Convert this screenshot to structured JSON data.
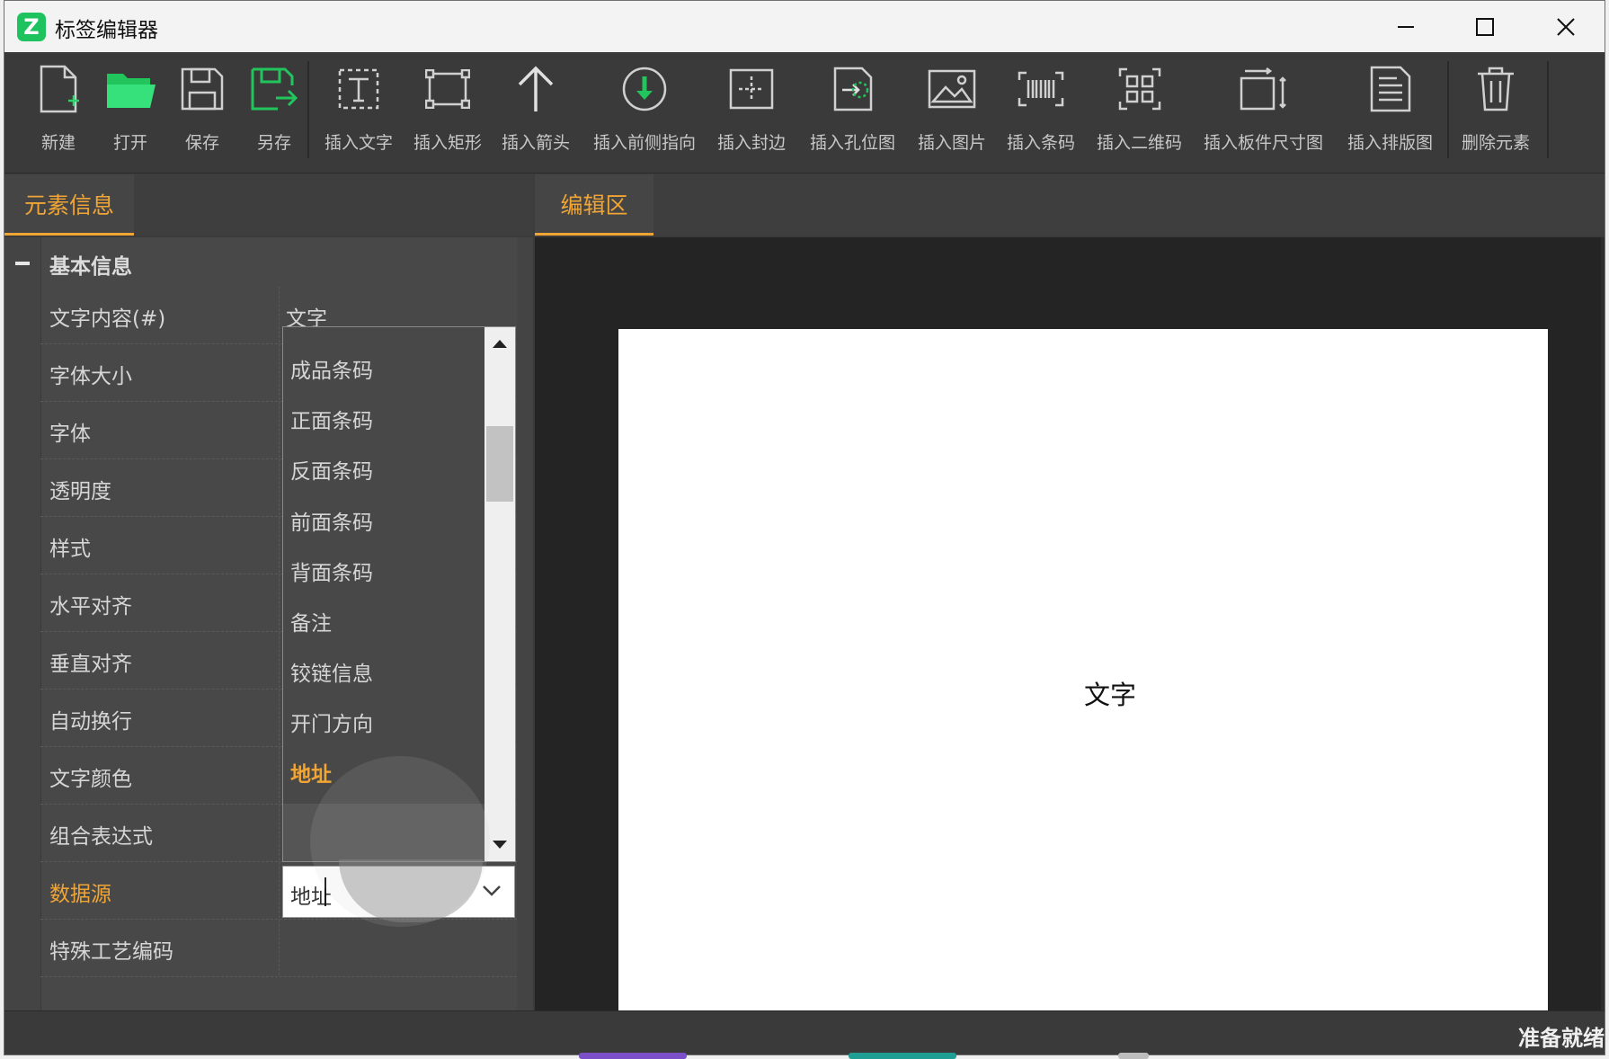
{
  "app": {
    "title": "标签编辑器",
    "icon_letter": "Z",
    "accent_color": "#f0a535",
    "brand_color": "#1ec25f"
  },
  "window_controls": {
    "minimize": "minimize-icon",
    "maximize": "maximize-icon",
    "close": "close-icon"
  },
  "toolbar": {
    "items": [
      {
        "label": "新建",
        "icon": "new-file-icon"
      },
      {
        "label": "打开",
        "icon": "open-folder-icon"
      },
      {
        "label": "保存",
        "icon": "save-icon"
      },
      {
        "label": "另存",
        "icon": "save-as-icon"
      },
      {
        "label": "插入文字",
        "icon": "insert-text-icon"
      },
      {
        "label": "插入矩形",
        "icon": "insert-rect-icon"
      },
      {
        "label": "插入箭头",
        "icon": "insert-arrow-icon"
      },
      {
        "label": "插入前侧指向",
        "icon": "insert-front-direction-icon"
      },
      {
        "label": "插入封边",
        "icon": "insert-edge-banding-icon"
      },
      {
        "label": "插入孔位图",
        "icon": "insert-hole-map-icon"
      },
      {
        "label": "插入图片",
        "icon": "insert-image-icon"
      },
      {
        "label": "插入条码",
        "icon": "insert-barcode-icon"
      },
      {
        "label": "插入二维码",
        "icon": "insert-qrcode-icon"
      },
      {
        "label": "插入板件尺寸图",
        "icon": "insert-panel-size-icon"
      },
      {
        "label": "插入排版图",
        "icon": "insert-layout-icon"
      },
      {
        "label": "删除元素",
        "icon": "delete-icon"
      }
    ]
  },
  "left_panel": {
    "tab_label": "元素信息",
    "section_title": "基本信息",
    "properties": [
      {
        "key": "文字内容(#)",
        "value": "文字"
      },
      {
        "key": "字体大小",
        "value": ""
      },
      {
        "key": "字体",
        "value": ""
      },
      {
        "key": "透明度",
        "value": ""
      },
      {
        "key": "样式",
        "value": ""
      },
      {
        "key": "水平对齐",
        "value": ""
      },
      {
        "key": "垂直对齐",
        "value": ""
      },
      {
        "key": "自动换行",
        "value": ""
      },
      {
        "key": "文字颜色",
        "value": ""
      },
      {
        "key": "组合表达式",
        "value": ""
      },
      {
        "key": "数据源",
        "value": ""
      },
      {
        "key": "特殊工艺编码",
        "value": ""
      }
    ],
    "dropdown": {
      "options": [
        "成品条码",
        "正面条码",
        "反面条码",
        "前面条码",
        "背面条码",
        "备注",
        "铰链信息",
        "开门方向",
        "地址"
      ],
      "highlighted": "地址",
      "selected_value": "地址"
    }
  },
  "right_panel": {
    "tab_label": "编辑区",
    "canvas_text": "文字"
  },
  "status": {
    "text": "准备就绪"
  }
}
